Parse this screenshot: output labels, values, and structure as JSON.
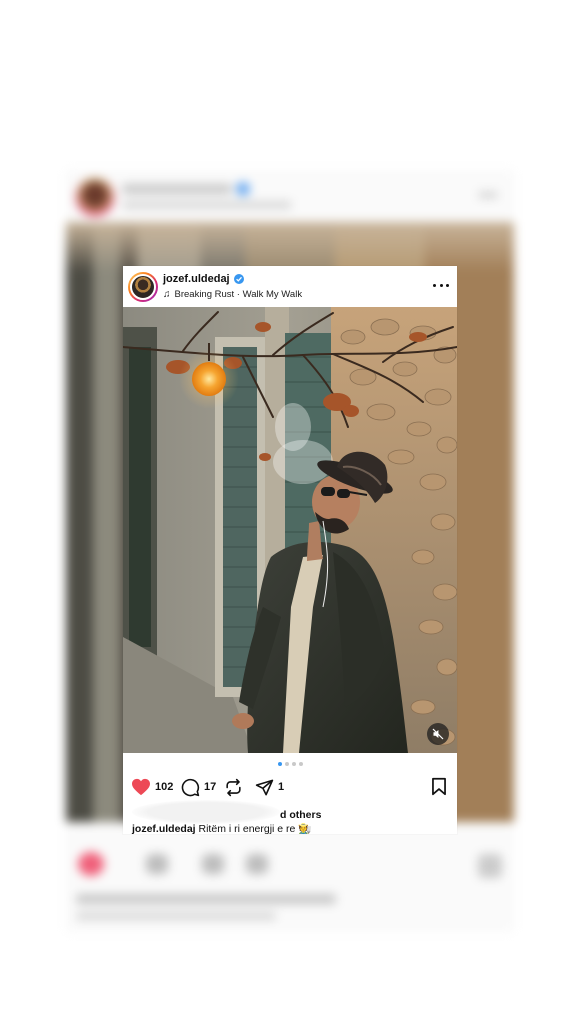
{
  "post": {
    "username": "jozef.uldedaj",
    "song": "Breaking Rust · Walk My Walk",
    "likes_count": "102",
    "comments_count": "17",
    "shares_count": "1",
    "likes_suffix": "d others",
    "caption_user": "jozef.uldedaj",
    "caption_text": "Ritëm i ri energji e re 🧑‍🌾",
    "carousel": {
      "total": 4,
      "active": 1
    }
  },
  "icons": {
    "verified": "verified-badge-icon",
    "music": "music-note-icon",
    "more": "more-options-icon",
    "heart": "heart-icon",
    "comment": "comment-icon",
    "repost": "repost-icon",
    "share": "send-icon",
    "save": "bookmark-icon",
    "mute": "mute-icon"
  },
  "colors": {
    "heart": "#ed4956",
    "verified": "#3897f0",
    "active_dot": "#3897f0"
  }
}
